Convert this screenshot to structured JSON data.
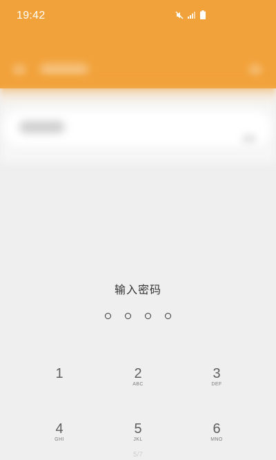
{
  "status_bar": {
    "time": "19:42",
    "icons": [
      "mute-icon",
      "signal-icon",
      "battery-icon"
    ],
    "background_color": "#f2a23a"
  },
  "lock_screen": {
    "prompt": "输入密码",
    "pin_length": 4,
    "pin_entered": 0,
    "keypad": [
      {
        "digit": "1",
        "letters": ""
      },
      {
        "digit": "2",
        "letters": "ABC"
      },
      {
        "digit": "3",
        "letters": "DEF"
      },
      {
        "digit": "4",
        "letters": "GHI"
      },
      {
        "digit": "5",
        "letters": "JKL"
      },
      {
        "digit": "6",
        "letters": "MNO"
      }
    ]
  },
  "page_indicator": "5/7",
  "colors": {
    "accent": "#f2a23a",
    "background": "#efefef",
    "text": "#333333"
  }
}
